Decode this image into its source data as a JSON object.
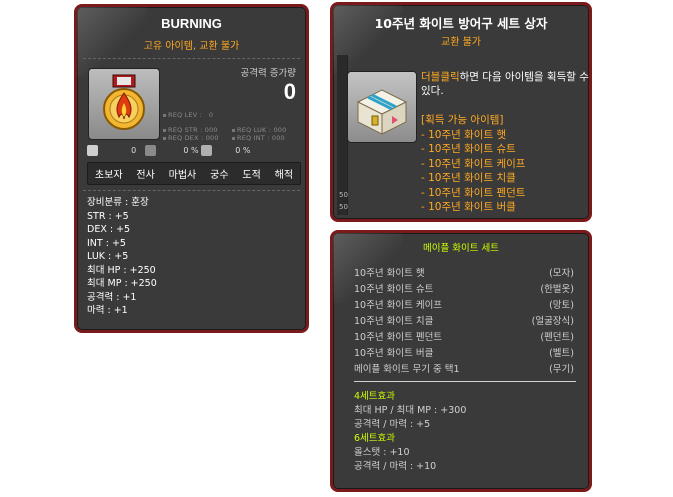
{
  "item": {
    "title": "BURNING",
    "subtitle": "고유 아이템, 교환 불가",
    "atk_label": "공격력 증가량",
    "atk_value": "0",
    "req_lev": "REQ LEV :",
    "req_lev_val": "0",
    "req_str": "REQ STR : 000",
    "req_luk": "REQ LUK : 000",
    "req_dex": "REQ DEX : 000",
    "req_int": "REQ INT : 000",
    "small_stats": [
      "0",
      "0 %",
      "0 %"
    ],
    "jobs": [
      "초보자",
      "전사",
      "마법사",
      "궁수",
      "도적",
      "해적"
    ],
    "stats": [
      "장비분류 : 훈장",
      "STR : +5",
      "DEX : +5",
      "INT : +5",
      "LUK : +5",
      "최대 HP : +250",
      "최대 MP : +250",
      "공격력 : +1",
      "마력 : +1"
    ]
  },
  "box": {
    "title": "10주년 화이트 방어구 세트 상자",
    "subtitle": "교환 불가",
    "desc_hl": "더블클릭",
    "desc_rest": "하면 다음 아이템을 획득할 수 있다.",
    "list_header": "[획득 가능 아이템]",
    "items": [
      "- 10주년 화이트 햇",
      "- 10주년 화이트 슈트",
      "- 10주년 화이트 케이프",
      "- 10주년 화이트 치클",
      "- 10주년 화이트 펜던트",
      "- 10주년 화이트 버클"
    ],
    "strip_numbers": [
      "50",
      "50"
    ]
  },
  "set": {
    "title": "메이플 화이트 세트",
    "rows": [
      {
        "name": "10주년 화이트 햇",
        "type": "(모자)"
      },
      {
        "name": "10주년 화이트 슈트",
        "type": "(한벌옷)"
      },
      {
        "name": "10주년 화이트 케이프",
        "type": "(망토)"
      },
      {
        "name": "10주년 화이트 치클",
        "type": "(얼굴장식)"
      },
      {
        "name": "10주년 화이트 펜던트",
        "type": "(펜던트)"
      },
      {
        "name": "10주년 화이트 버클",
        "type": "(벨트)"
      },
      {
        "name": "메이플 화이트 무기 중 택1",
        "type": "(무기)"
      }
    ],
    "effect4_title": "4세트효과",
    "effect4": [
      "최대 HP / 최대 MP : +300",
      "공격력 / 마력 : +5"
    ],
    "effect6_title": "6세트효과",
    "effect6": [
      "올스탯 : +10",
      "공격력 / 마력 : +10"
    ]
  },
  "colors": {
    "panel_bg": "#3a3a3a",
    "panel_border": "#7a1a1a",
    "orange": "#ffaa22",
    "set_green": "#ccff00"
  }
}
